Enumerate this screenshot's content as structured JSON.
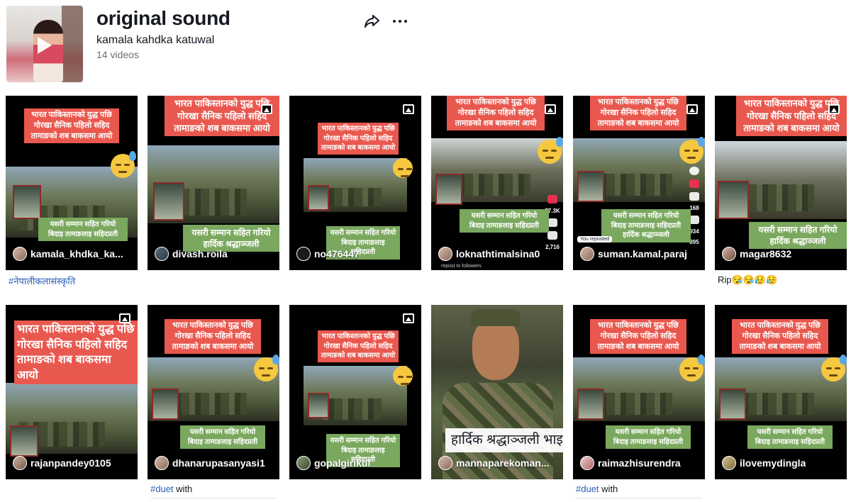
{
  "header": {
    "title": "original sound",
    "author": "kamala kahdka katuwal",
    "video_count": "14 videos",
    "share_icon": "share-icon",
    "more_icon": "more-icon"
  },
  "red_banner": {
    "line1": "भारत पाकिस्तानको युद्ध पछि",
    "line2": "गोरखा सैनिक पहिलो सहिद",
    "line3": "तामाङको शब बाकसमा आयो"
  },
  "green_banner": {
    "line1": "यसरी सम्मान सहित गरियो",
    "line2": "बिदाइ तामाङलाइ सहिदप्रती",
    "line3": "हार्दिक श्रद्धाञ्जली"
  },
  "videos": [
    {
      "username": "kamala_khdka_ka...",
      "caption_tag": "#नेपालीकलासंस्कृति",
      "caption_text": ""
    },
    {
      "username": "divash.roila",
      "caption_tag": "",
      "caption_text": ""
    },
    {
      "username": "no476447",
      "caption_tag": "",
      "caption_text": ""
    },
    {
      "username": "loknathtimalsina0",
      "caption_tag": "",
      "caption_text": "",
      "side_count_1": "57.3K",
      "side_count_2": "2,716",
      "overlay": "repost to followers"
    },
    {
      "username": "suman.kamal.paraj",
      "caption_tag": "",
      "caption_text": "",
      "reposted": "You reposted",
      "side_count_1": "168",
      "side_count_2": "934",
      "side_count_3": "895"
    },
    {
      "username": "magar8632",
      "caption_tag": "",
      "caption_text": "Rip😪😪😥😥"
    },
    {
      "username": "rajanpandey0105",
      "caption_tag": "",
      "caption_text": ""
    },
    {
      "username": "dhanarupasanyasi1",
      "caption_tag": "#duet",
      "caption_text": "with"
    },
    {
      "username": "gopalgirikul",
      "caption_tag": "",
      "caption_text": ""
    },
    {
      "username": "mannaparekoman...",
      "caption_tag": "",
      "caption_text": "",
      "banner": "हार्दिक श्रद्धाञ्जली भाइ"
    },
    {
      "username": "raimazhisurendra",
      "caption_tag": "#duet",
      "caption_text": "with"
    },
    {
      "username": "ilovemydingla",
      "caption_tag": "",
      "caption_text": ""
    }
  ]
}
